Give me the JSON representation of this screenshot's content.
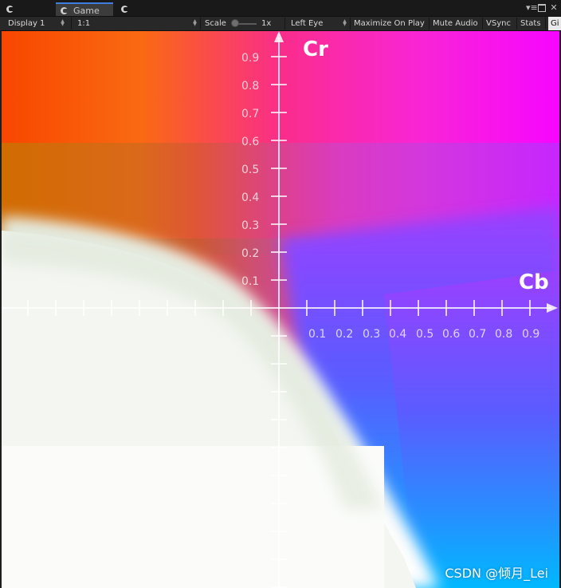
{
  "tabs": [
    {
      "label": "",
      "icon": "unity-icon"
    },
    {
      "label": "Game",
      "icon": "unity-icon",
      "active": true
    },
    {
      "label": "",
      "icon": "unity-icon"
    }
  ],
  "window_controls": {
    "menu_icon": "menu-icon",
    "maximize_icon": "maximize-icon",
    "close_icon": "close-icon"
  },
  "toolbar": {
    "display": "Display 1",
    "aspect": "1:1",
    "scale_label": "Scale",
    "scale_value": "1x",
    "eye": "Left Eye",
    "maximize_on_play": "Maximize On Play",
    "mute_audio": "Mute Audio",
    "vsync": "VSync",
    "stats": "Stats",
    "gizmos": "Gi"
  },
  "game_view": {
    "y_axis_label": "Cr",
    "x_axis_label": "Cb",
    "y_ticks": [
      "0.9",
      "0.8",
      "0.7",
      "0.6",
      "0.5",
      "0.4",
      "0.3",
      "0.2",
      "0.1"
    ],
    "x_ticks": [
      "0.1",
      "0.2",
      "0.3",
      "0.4",
      "0.5",
      "0.6",
      "0.7",
      "0.8",
      "0.9"
    ],
    "watermark": "CSDN @倾月_Lei"
  },
  "colors": {
    "accent_tab": "#3e7de0",
    "top_left": "#ff4000",
    "top_right": "#ff00ff",
    "bottom_right": "#00b0ff",
    "bottom_left": "#f8faf8"
  }
}
